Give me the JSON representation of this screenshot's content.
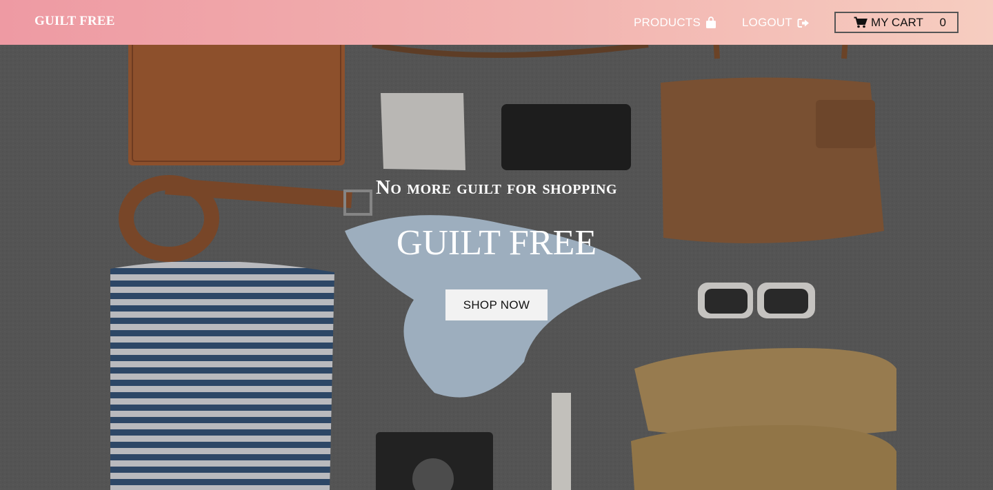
{
  "navbar": {
    "brand": "GUILT FREE",
    "products_label": "PRODUCTS",
    "products_icon": "shopping-bag-icon",
    "logout_label": "LOGOUT",
    "logout_icon": "sign-out-icon",
    "cart_label": "MY CART",
    "cart_icon": "shopping-cart-icon",
    "cart_count": "0"
  },
  "hero": {
    "tagline": "No more guilt for shopping",
    "title": "GUILT FREE",
    "cta_label": "SHOP NOW"
  },
  "colors": {
    "navbar_gradient_start": "#ee9aa3",
    "navbar_gradient_end": "#f6cdc0",
    "hero_background": "#5d5d5d",
    "cta_background": "#f2f2f2"
  }
}
